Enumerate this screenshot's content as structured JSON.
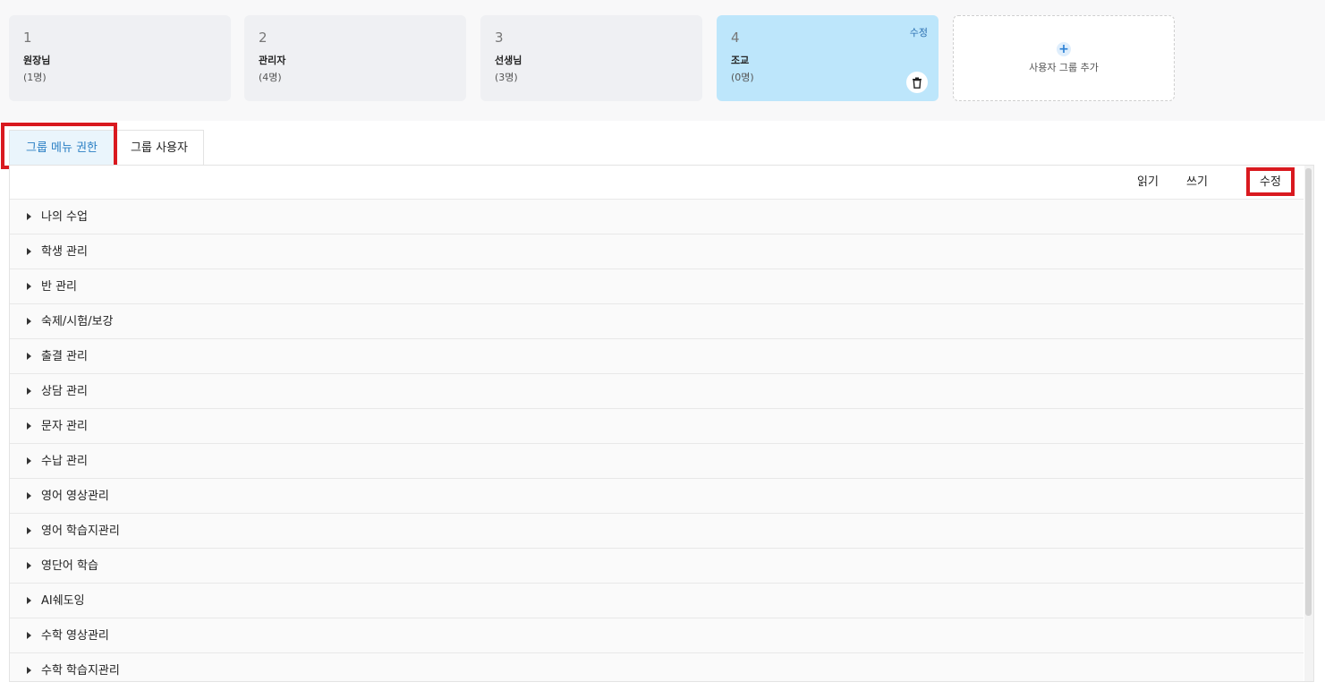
{
  "groups": [
    {
      "number": "1",
      "name": "원장님",
      "count": "(1명)"
    },
    {
      "number": "2",
      "name": "관리자",
      "count": "(4명)"
    },
    {
      "number": "3",
      "name": "선생님",
      "count": "(3명)"
    },
    {
      "number": "4",
      "name": "조교",
      "count": "(0명)",
      "edit_label": "수정"
    }
  ],
  "add_group": {
    "plus": "+",
    "label": "사용자 그룹 추가"
  },
  "tabs": [
    {
      "label": "그룹 메뉴 권한",
      "active": true
    },
    {
      "label": "그룹 사용자",
      "active": false
    }
  ],
  "table_header": {
    "read": "읽기",
    "write": "쓰기",
    "edit": "수정"
  },
  "menu_rows": [
    "나의 수업",
    "학생 관리",
    "반 관리",
    "숙제/시험/보강",
    "출결 관리",
    "상담 관리",
    "문자 관리",
    "수납 관리",
    "영어 영상관리",
    "영어 학습지관리",
    "영단어 학습",
    "AI쉐도잉",
    "수학 영상관리",
    "수학 학습지관리"
  ],
  "colors": {
    "accent": "#2a7fc4",
    "selected_card": "#bde6fb",
    "highlight": "#d9191f"
  },
  "icons": {
    "expand": "triangle-right-icon",
    "delete": "trash-icon",
    "add": "plus-icon"
  }
}
